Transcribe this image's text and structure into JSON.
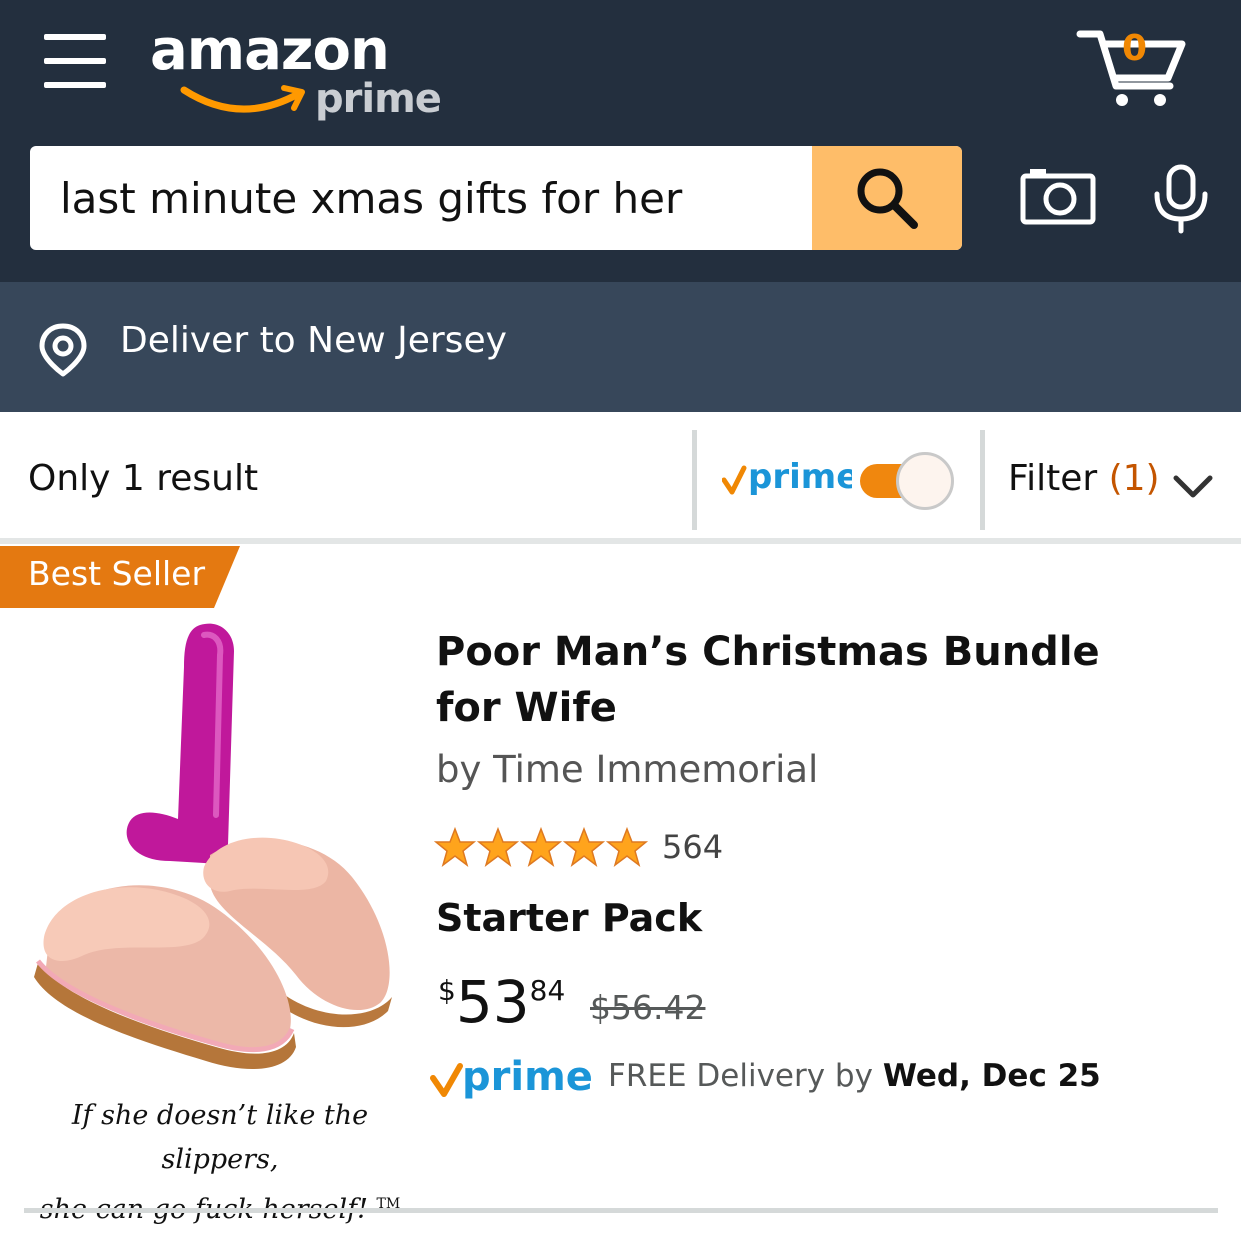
{
  "header": {
    "logo_text": "amazon",
    "logo_sub": "prime",
    "cart_count": "0",
    "search": {
      "value": "last minute xmas gifts for her"
    },
    "colors": {
      "background": "#232f3e",
      "search_button": "#febd69",
      "cart_count": "#f08804"
    },
    "icons": [
      "menu-icon",
      "search-icon",
      "camera-icon",
      "microphone-icon",
      "cart-icon"
    ]
  },
  "delivery_bar": {
    "text": "Deliver to New Jersey",
    "icon": "location-pin-icon",
    "background": "#37475a"
  },
  "results_bar": {
    "count_text": "Only 1 result",
    "prime_label": "prime",
    "prime_toggle_on": true,
    "filter_label": "Filter",
    "filter_count": "(1)"
  },
  "product": {
    "badge": "Best Seller",
    "badge_color": "#e47911",
    "title": "Poor Man’s Christmas Bundle for Wife",
    "brand": "by Time Immemorial",
    "rating_stars": 5,
    "review_count": "564",
    "variant": "Starter Pack",
    "price_symbol": "$",
    "price_whole": "53",
    "price_fraction": "84",
    "list_price": "$56.42",
    "prime_label": "prime",
    "delivery_prefix": "FREE Delivery by",
    "delivery_date": "Wed, Dec 25",
    "caption_line1": "If she doesn’t like the slippers,",
    "caption_line2": "she can go fuck herself!",
    "caption_tm": "TM"
  }
}
